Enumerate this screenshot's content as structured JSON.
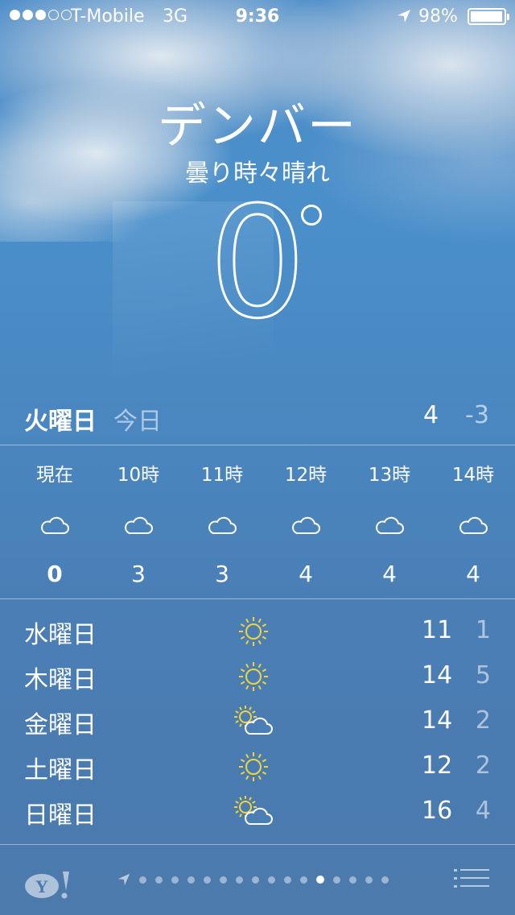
{
  "status_bar": {
    "signal_filled": 3,
    "signal_total": 5,
    "carrier": "T-Mobile",
    "network": "3G",
    "time": "9:36",
    "battery_percent_text": "98%",
    "battery_level": 0.98
  },
  "location": {
    "city": "デンバー",
    "condition": "曇り時々晴れ",
    "temperature": "0"
  },
  "today": {
    "day": "火曜日",
    "label": "今日",
    "high": "4",
    "low": "-3"
  },
  "hourly": [
    {
      "time": "現在",
      "icon": "cloud-icon",
      "temp": "0"
    },
    {
      "time": "10時",
      "icon": "cloud-icon",
      "temp": "3"
    },
    {
      "time": "11時",
      "icon": "cloud-icon",
      "temp": "3"
    },
    {
      "time": "12時",
      "icon": "cloud-icon",
      "temp": "4"
    },
    {
      "time": "13時",
      "icon": "cloud-icon",
      "temp": "4"
    },
    {
      "time": "14時",
      "icon": "cloud-icon",
      "temp": "4"
    }
  ],
  "daily": [
    {
      "day": "水曜日",
      "icon": "sun-icon",
      "high": "11",
      "low": "1"
    },
    {
      "day": "木曜日",
      "icon": "sun-icon",
      "high": "14",
      "low": "5"
    },
    {
      "day": "金曜日",
      "icon": "partly-cloudy-icon",
      "high": "14",
      "low": "2"
    },
    {
      "day": "土曜日",
      "icon": "sun-icon",
      "high": "12",
      "low": "2"
    },
    {
      "day": "日曜日",
      "icon": "partly-cloudy-icon",
      "high": "16",
      "low": "4"
    }
  ],
  "toolbar": {
    "page_count": 17,
    "active_page": 13,
    "icons": [
      "yahoo-logo-icon",
      "location-arrow-icon",
      "list-icon"
    ]
  },
  "colors": {
    "sun": "#f2d43a",
    "text": "#ffffff"
  }
}
